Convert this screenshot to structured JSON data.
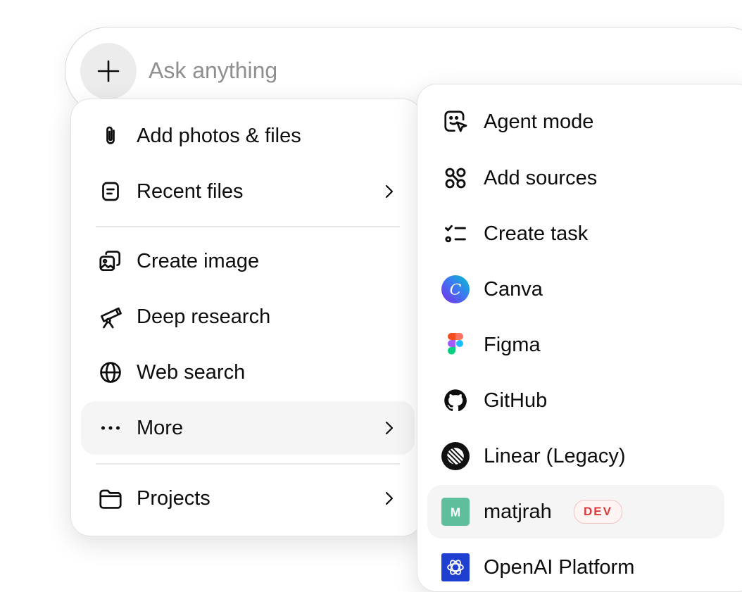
{
  "composer": {
    "placeholder": "Ask anything"
  },
  "menu": {
    "items": [
      {
        "label": "Add photos & files",
        "icon": "paperclip-icon"
      },
      {
        "label": "Recent files",
        "icon": "document-icon",
        "has_submenu": true
      },
      {
        "label": "Create image",
        "icon": "image-icon"
      },
      {
        "label": "Deep research",
        "icon": "telescope-icon"
      },
      {
        "label": "Web search",
        "icon": "globe-icon"
      },
      {
        "label": "More",
        "icon": "ellipsis-icon",
        "has_submenu": true,
        "active": true
      },
      {
        "label": "Projects",
        "icon": "folder-icon",
        "has_submenu": true
      }
    ]
  },
  "submenu": {
    "items": [
      {
        "label": "Agent mode",
        "icon": "agent-cursor-icon"
      },
      {
        "label": "Add sources",
        "icon": "connectors-icon"
      },
      {
        "label": "Create task",
        "icon": "checklist-icon"
      },
      {
        "label": "Canva",
        "icon": "canva-logo-icon",
        "letter": "C"
      },
      {
        "label": "Figma",
        "icon": "figma-logo-icon"
      },
      {
        "label": "GitHub",
        "icon": "github-logo-icon"
      },
      {
        "label": "Linear (Legacy)",
        "icon": "linear-logo-icon"
      },
      {
        "label": "matjrah",
        "icon": "matjrah-avatar-icon",
        "letter": "M",
        "badge": "DEV",
        "active": true
      },
      {
        "label": "OpenAI Platform",
        "icon": "openai-logo-icon"
      }
    ]
  },
  "colors": {
    "active_bg": "#f5f5f5",
    "badge_text": "#d93c3c",
    "matjrah_avatar": "#5fbf9d",
    "openai_tile": "#1f3fd1"
  }
}
